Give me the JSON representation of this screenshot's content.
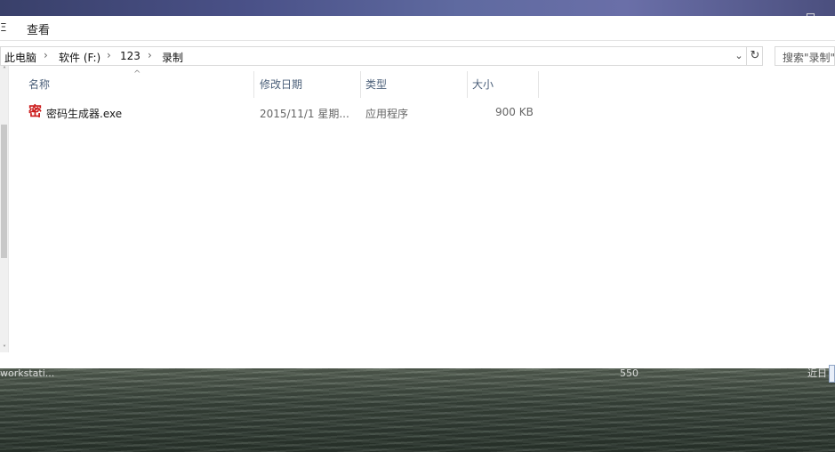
{
  "ribbon": {
    "edge_glyph": "Ξ",
    "tab_view": "查看"
  },
  "breadcrumb": [
    {
      "label": "此电脑"
    },
    {
      "label": "软件 (F:)"
    },
    {
      "label": "123"
    },
    {
      "label": "录制"
    }
  ],
  "address_dropdown_icon": "chevron-down-icon",
  "refresh_icon": "refresh-icon",
  "search": {
    "placeholder": "搜索\"录制\""
  },
  "columns": [
    {
      "label": "名称"
    },
    {
      "label": "修改日期"
    },
    {
      "label": "类型"
    },
    {
      "label": "大小"
    }
  ],
  "files": [
    {
      "icon_char": "密",
      "name": "密码生成器.exe",
      "modified": "2015/11/1 星期...",
      "type": "应用程序",
      "size": "900 KB"
    }
  ],
  "desktop": {
    "text_left": "workstati...",
    "text_mid": "550",
    "text_right": "近日"
  }
}
